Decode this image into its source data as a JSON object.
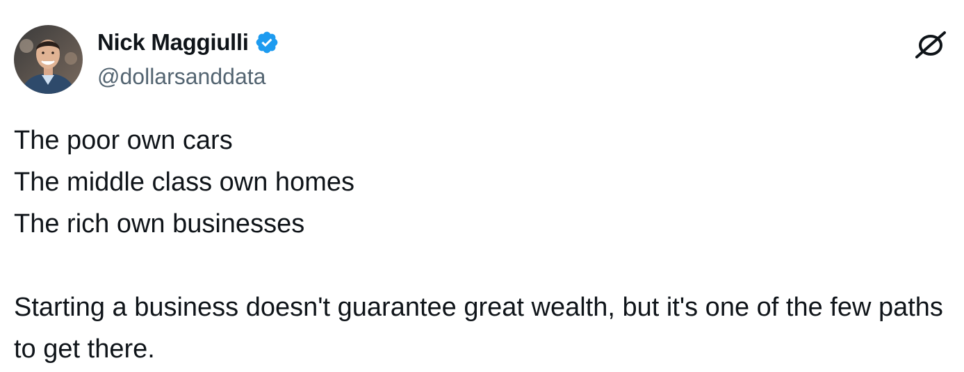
{
  "author": {
    "display_name": "Nick Maggiulli",
    "handle": "@dollarsanddata",
    "verified": true,
    "verified_color": "#1d9bf0"
  },
  "icons": {
    "platform_logo": "x-logo-icon",
    "verified": "verified-badge-icon"
  },
  "tweet": {
    "lines": [
      "The poor own cars",
      "The middle class own homes",
      "The rich own businesses"
    ],
    "paragraph": "Starting a business doesn't guarantee great wealth, but it's one of the few paths to get there."
  },
  "colors": {
    "text": "#0f1419",
    "secondary_text": "#536471",
    "background": "#ffffff"
  }
}
